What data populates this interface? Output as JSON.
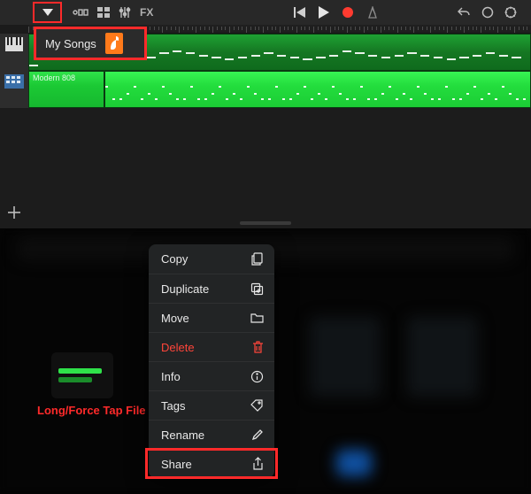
{
  "toolbar": {
    "fx_label": "FX"
  },
  "mysongs": {
    "label": "My Songs"
  },
  "tracks": {
    "track2_label": "Modern 808"
  },
  "annotation": {
    "long_tap": "Long/Force Tap File"
  },
  "context_menu": {
    "items": [
      {
        "label": "Copy",
        "icon": "copy-icon"
      },
      {
        "label": "Duplicate",
        "icon": "duplicate-icon"
      },
      {
        "label": "Move",
        "icon": "folder-icon"
      },
      {
        "label": "Delete",
        "icon": "trash-icon",
        "destructive": true
      },
      {
        "label": "Info",
        "icon": "info-icon"
      },
      {
        "label": "Tags",
        "icon": "tag-icon"
      },
      {
        "label": "Rename",
        "icon": "pencil-icon"
      },
      {
        "label": "Share",
        "icon": "share-icon"
      }
    ]
  },
  "colors": {
    "highlight": "#ff2a2a",
    "region_green": "#23dd3d"
  }
}
